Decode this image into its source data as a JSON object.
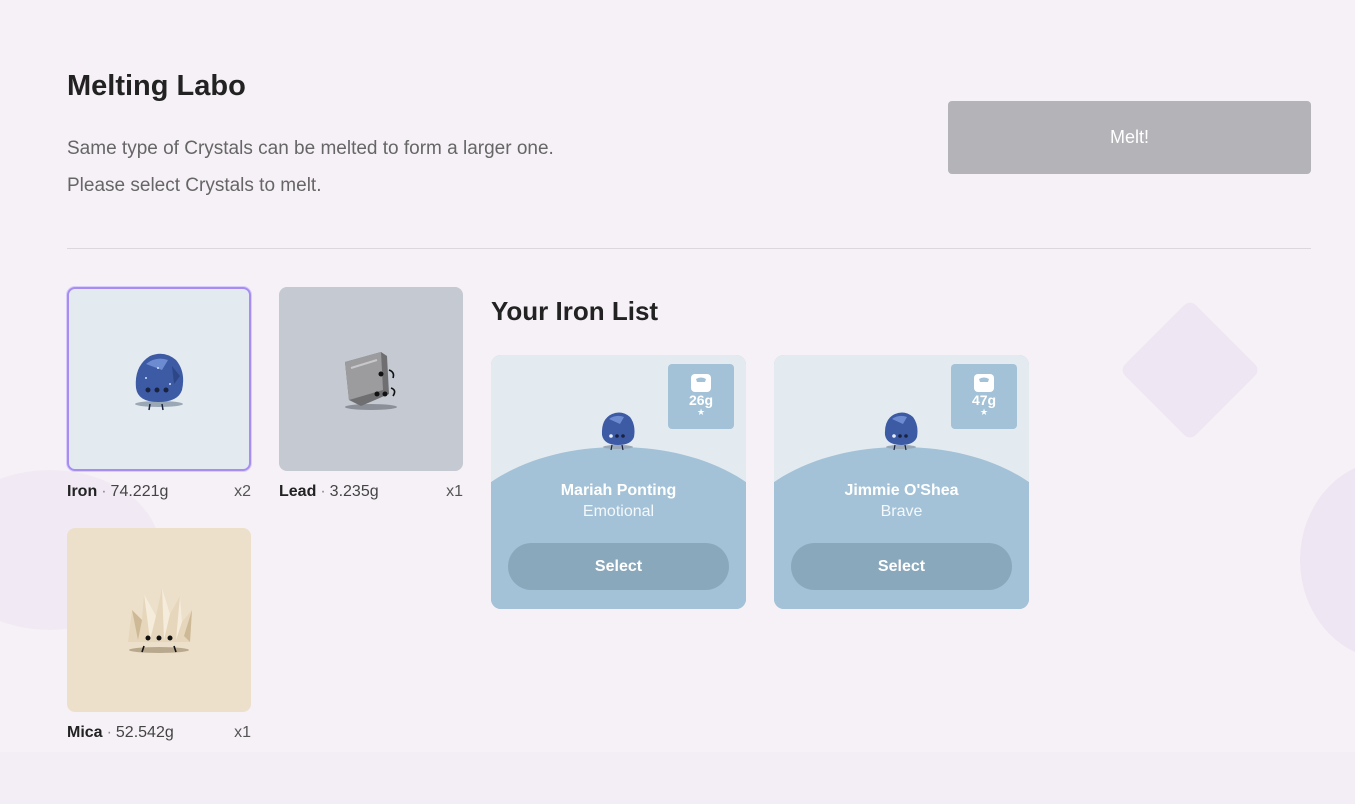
{
  "header": {
    "title": "Melting Labo",
    "desc_line1": "Same type of Crystals can be melted to form a larger one.",
    "desc_line2": "Please select Crystals to melt.",
    "melt_label": "Melt!"
  },
  "crystals": [
    {
      "name": "Iron",
      "weight": "74.221g",
      "count": "x2",
      "selected": true,
      "color": "#3f5ea8"
    },
    {
      "name": "Lead",
      "weight": "3.235g",
      "count": "x1",
      "selected": false,
      "color": "#9a9a9a"
    },
    {
      "name": "Mica",
      "weight": "52.542g",
      "count": "x1",
      "selected": false,
      "color": "#e2cfae"
    }
  ],
  "list": {
    "title": "Your Iron List",
    "items": [
      {
        "name": "Mariah Ponting",
        "trait": "Emotional",
        "weight": "26g",
        "select_label": "Select"
      },
      {
        "name": "Jimmie O'Shea",
        "trait": "Brave",
        "weight": "47g",
        "select_label": "Select"
      }
    ]
  },
  "colors": {
    "accent_border": "#a78df0",
    "card_blue": "#a3c2d7",
    "melt_disabled": "#b4b3b8"
  },
  "icons": {
    "weight": "weight-scale-icon",
    "star": "star-icon"
  }
}
